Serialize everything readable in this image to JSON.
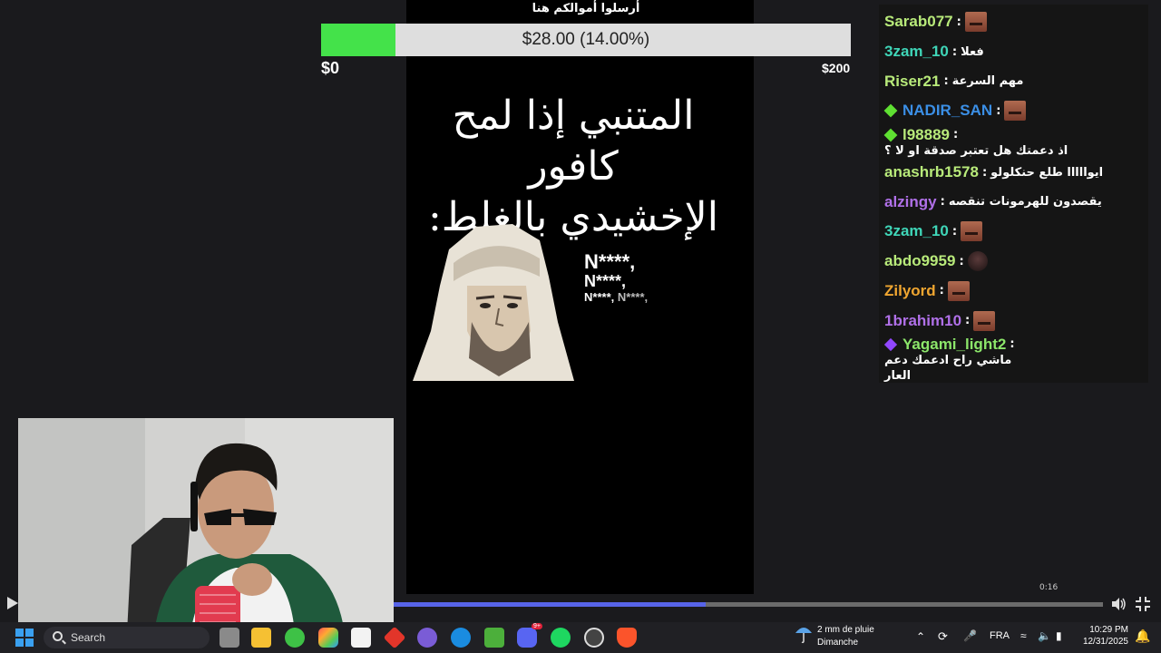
{
  "goal": {
    "title": "أرسلوا أموالكم هنا",
    "progress_text": "$28.00 (14.00%)",
    "progress_fraction": 0.14,
    "min_label": "$0",
    "max_label": "$200",
    "fill_color": "#44e24a"
  },
  "meme": {
    "caption_line1": "المتنبي إذا لمح كافور",
    "caption_line2": "الإخشيدي بالغلط:",
    "n_word_1": "N****,",
    "n_word_2": "N****,",
    "n_word_3a": "N****,",
    "n_word_3b": "N****,"
  },
  "chat": {
    "messages": [
      {
        "user": "Sarab077",
        "color": "#b8ea7a",
        "text": "",
        "emote": "face"
      },
      {
        "user": "3zam_10",
        "color": "#3fd6b8",
        "text": "فعلا",
        "emote": ""
      },
      {
        "user": "Riser21",
        "color": "#b8ea7a",
        "text": "مهم السرعة",
        "emote": ""
      },
      {
        "user": "NADIR_SAN",
        "color": "#3b8fe6",
        "text": "",
        "emote": "face",
        "badge": "green"
      },
      {
        "user": "l98889",
        "color": "#b8ea7a",
        "text": "اذ دعمتك هل تعتبر صدقة او لا ؟",
        "emote": "",
        "badge": "green"
      },
      {
        "user": "anashrb1578",
        "color": "#b8ea7a",
        "text": "ايوااااا طلع حنكلولو",
        "emote": ""
      },
      {
        "user": "alzingy",
        "color": "#b070e8",
        "text": "يقصدون للهرمونات تنقصه",
        "emote": ""
      },
      {
        "user": "3zam_10",
        "color": "#3fd6b8",
        "text": "",
        "emote": "face"
      },
      {
        "user": "abdo9959",
        "color": "#b8ea7a",
        "text": "",
        "emote": "dark"
      },
      {
        "user": "Zilyord",
        "color": "#f0a630",
        "text": "",
        "emote": "face"
      },
      {
        "user": "1brahim10",
        "color": "#b070e8",
        "text": "",
        "emote": "face"
      },
      {
        "user": "Yagami_light2",
        "color": "#8ce66a",
        "text": "ماشي راح ادعمك دعم",
        "text2": "العار",
        "emote": "",
        "badge": "purple"
      }
    ]
  },
  "player": {
    "time": "0:16",
    "progress_fraction": 0.44,
    "accent": "#5764e8"
  },
  "taskbar": {
    "search_label": "Search",
    "weather_line1": "2 mm de pluie",
    "weather_line2": "Dimanche",
    "language": "FRA",
    "time": "10:29 PM",
    "date": "12/31/2025",
    "discord_badge": "9+"
  }
}
